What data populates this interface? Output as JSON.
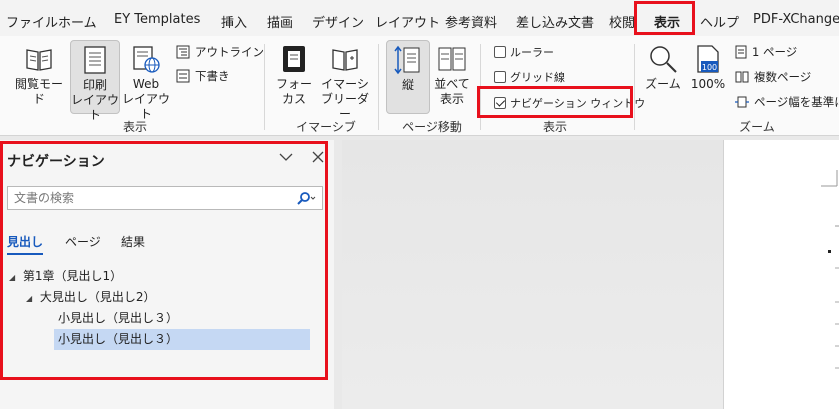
{
  "menu": {
    "tabs": [
      {
        "label": "ファイル",
        "active": false
      },
      {
        "label": "ホーム",
        "active": false
      },
      {
        "label": "EY Templates",
        "active": false
      },
      {
        "label": "挿入",
        "active": false
      },
      {
        "label": "描画",
        "active": false
      },
      {
        "label": "デザイン",
        "active": false
      },
      {
        "label": "レイアウト",
        "active": false
      },
      {
        "label": "参考資料",
        "active": false
      },
      {
        "label": "差し込み文書",
        "active": false
      },
      {
        "label": "校閲",
        "active": false
      },
      {
        "label": "表示",
        "active": true
      },
      {
        "label": "ヘルプ",
        "active": false
      },
      {
        "label": "PDF-XChange",
        "active": false
      }
    ]
  },
  "ribbon": {
    "views": {
      "read_mode": [
        "閲覧モード"
      ],
      "print_layout": [
        "印刷",
        "レイアウト"
      ],
      "web_layout": [
        "Web",
        "レイアウト"
      ],
      "outline": "アウトライン",
      "draft": "下書き",
      "group_label": "表示"
    },
    "immersive": {
      "focus": [
        "フォー",
        "カス"
      ],
      "immersive_reader": [
        "イマーシ",
        "ブリーダー"
      ],
      "group_label": "イマーシブ"
    },
    "page_movement": {
      "vertical": "縦",
      "side_by_side": [
        "並べて",
        "表示"
      ],
      "group_label": "ページ移動"
    },
    "show": {
      "ruler": {
        "label": "ルーラー",
        "checked": false
      },
      "gridlines": {
        "label": "グリッド線",
        "checked": false
      },
      "nav_pane": {
        "label": "ナビゲーション ウィンドウ",
        "checked": true
      },
      "group_label": "表示"
    },
    "zoom": {
      "zoom": "ズーム",
      "hundred": "100%",
      "hundred_icon_text": "100",
      "one_page": "1 ページ",
      "multiple_pages": "複数ページ",
      "page_width": "ページ幅を基準に",
      "group_label": "ズーム"
    }
  },
  "navigation": {
    "title": "ナビゲーション",
    "search_placeholder": "文書の検索",
    "tabs": [
      "見出し",
      "ページ",
      "結果"
    ],
    "headings": [
      {
        "label": "第1章（見出し1）",
        "level": 1,
        "expanded": true,
        "selected": false
      },
      {
        "label": "大見出し（見出し2）",
        "level": 2,
        "expanded": true,
        "selected": false
      },
      {
        "label": "小見出し（見出し３）",
        "level": 3,
        "expanded": false,
        "selected": false
      },
      {
        "label": "小見出し（見出し３）",
        "level": 3,
        "expanded": false,
        "selected": true
      }
    ]
  },
  "colors": {
    "accent": "#185abd",
    "highlight_box": "#e8101c",
    "selected_row": "#c5d8f3"
  }
}
